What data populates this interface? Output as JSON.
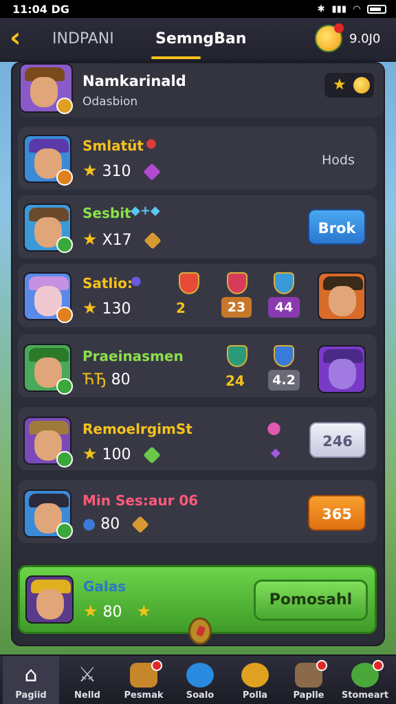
{
  "status_bar": {
    "time": "11:04 DG"
  },
  "header": {
    "back_icon": "chevron-left-icon",
    "tabs": [
      {
        "label": "INDPANI"
      },
      {
        "label": "SemngBan"
      }
    ],
    "coin_value": "9.0J0"
  },
  "profile": {
    "name": "Namkarinald",
    "subtitle": "Odasbion"
  },
  "rows": [
    {
      "name": "Smlatüt",
      "name_color": "#f5c21b",
      "stat": "310",
      "right_text": "Hods",
      "accent": "#b04ad0"
    },
    {
      "name": "Sesbit",
      "name_color": "#8be04a",
      "stat": "X17",
      "button": "Brok",
      "accent": "#d69a30"
    },
    {
      "name": "Satlio:",
      "name_color": "#f5c21b",
      "stat": "130",
      "chips": [
        "2",
        "23",
        "44"
      ],
      "accent": "#5a6ad8"
    },
    {
      "name": "Praeinasmen",
      "name_color": "#8be04a",
      "stat_prefix": "ЋЂ",
      "stat": "80",
      "chips": [
        "24",
        "4.2"
      ],
      "accent": "#3a9a4a"
    },
    {
      "name": "RemoelrgimSt",
      "name_color": "#f5c21b",
      "stat": "100",
      "button": "246",
      "accent": "#8a50c8"
    },
    {
      "name": "Min Ses:aur 06",
      "name_color": "#ff5a7a",
      "stat": "80",
      "button": "365",
      "accent": "#2a8ac8"
    }
  ],
  "featured": {
    "name": "Galas",
    "stat": "80",
    "button": "Pomosahl"
  },
  "bottom_nav": [
    {
      "label": "Pagiid",
      "icon": "home-icon",
      "active": true
    },
    {
      "label": "Nelld",
      "icon": "swords-icon"
    },
    {
      "label": "Pesmak",
      "icon": "trophy-icon"
    },
    {
      "label": "Soalo",
      "icon": "battle-icon"
    },
    {
      "label": "Polla",
      "icon": "character-icon"
    },
    {
      "label": "Paplle",
      "icon": "chest-icon"
    },
    {
      "label": "Stomeart",
      "icon": "shop-icon"
    }
  ]
}
